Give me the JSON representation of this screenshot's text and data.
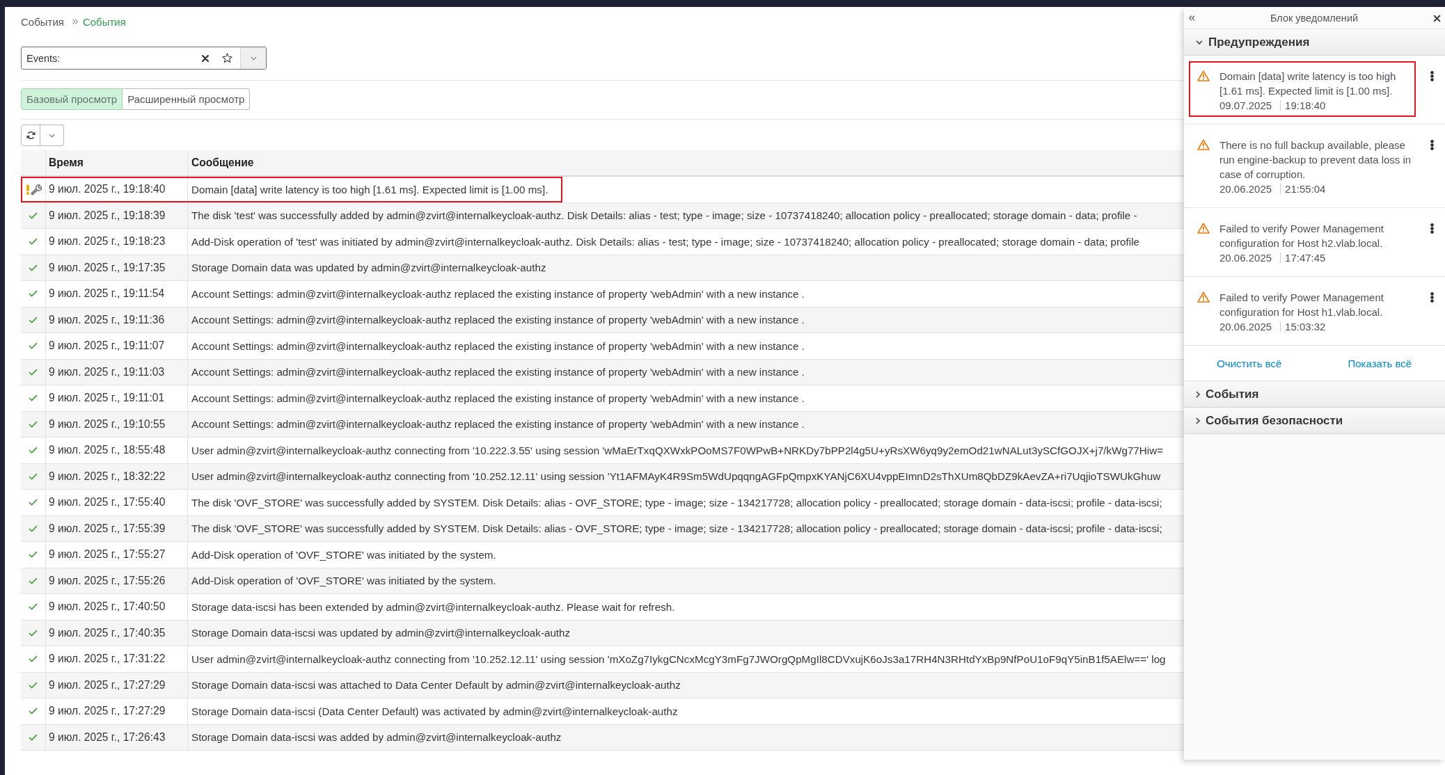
{
  "breadcrumb": [
    {
      "label": "События",
      "current": false
    },
    {
      "label": "События",
      "current": true
    }
  ],
  "search": {
    "label": "Events:"
  },
  "view_toggle": [
    {
      "label": "Базовый просмотр",
      "selected": true
    },
    {
      "label": "Расширенный просмотр",
      "selected": false
    }
  ],
  "table": {
    "columns": [
      "Время",
      "Сообщение"
    ],
    "rows": [
      {
        "kind": "warning",
        "time": "9 июл. 2025 г., 19:18:40",
        "message": "Domain [data] write latency is too high [1.61 ms]. Expected limit is [1.00 ms].",
        "highlighted": true
      },
      {
        "kind": "success",
        "time": "9 июл. 2025 г., 19:18:39",
        "message": "The disk 'test' was successfully added by admin@zvirt@internalkeycloak-authz. Disk Details: alias - test; type - image; size - 10737418240; allocation policy - preallocated; storage domain - data; profile -",
        "highlighted": false
      },
      {
        "kind": "success",
        "time": "9 июл. 2025 г., 19:18:23",
        "message": "Add-Disk operation of 'test' was initiated by admin@zvirt@internalkeycloak-authz. Disk Details: alias - test; type - image; size - 10737418240; allocation policy - preallocated; storage domain - data; profile",
        "highlighted": false
      },
      {
        "kind": "success",
        "time": "9 июл. 2025 г., 19:17:35",
        "message": "Storage Domain data was updated by admin@zvirt@internalkeycloak-authz",
        "highlighted": false
      },
      {
        "kind": "success",
        "time": "9 июл. 2025 г., 19:11:54",
        "message": "Account Settings: admin@zvirt@internalkeycloak-authz replaced the existing instance of property 'webAdmin' with a new instance .",
        "highlighted": false
      },
      {
        "kind": "success",
        "time": "9 июл. 2025 г., 19:11:36",
        "message": "Account Settings: admin@zvirt@internalkeycloak-authz replaced the existing instance of property 'webAdmin' with a new instance .",
        "highlighted": false
      },
      {
        "kind": "success",
        "time": "9 июл. 2025 г., 19:11:07",
        "message": "Account Settings: admin@zvirt@internalkeycloak-authz replaced the existing instance of property 'webAdmin' with a new instance .",
        "highlighted": false
      },
      {
        "kind": "success",
        "time": "9 июл. 2025 г., 19:11:03",
        "message": "Account Settings: admin@zvirt@internalkeycloak-authz replaced the existing instance of property 'webAdmin' with a new instance .",
        "highlighted": false
      },
      {
        "kind": "success",
        "time": "9 июл. 2025 г., 19:11:01",
        "message": "Account Settings: admin@zvirt@internalkeycloak-authz replaced the existing instance of property 'webAdmin' with a new instance .",
        "highlighted": false
      },
      {
        "kind": "success",
        "time": "9 июл. 2025 г., 19:10:55",
        "message": "Account Settings: admin@zvirt@internalkeycloak-authz replaced the existing instance of property 'webAdmin' with a new instance .",
        "highlighted": false
      },
      {
        "kind": "success",
        "time": "9 июл. 2025 г., 18:55:48",
        "message": "User admin@zvirt@internalkeycloak-authz connecting from '10.222.3.55' using session 'wMaErTxqQXWxkPOoMS7F0WPwB+NRKDy7bPP2l4g5U+yRsXW6yq9y2emOd21wNALut3ySCfGOJX+j7/kWg77Hiw=",
        "highlighted": false
      },
      {
        "kind": "success",
        "time": "9 июл. 2025 г., 18:32:22",
        "message": "User admin@zvirt@internalkeycloak-authz connecting from '10.252.12.11' using session 'Yt1AFMAyK4R9Sm5WdUpqqngAGFpQmpxKYANjC6XU4vppEImnD2sThXUm8QbDZ9kAevZA+ri7UqjioTSWUkGhuw",
        "highlighted": false
      },
      {
        "kind": "success",
        "time": "9 июл. 2025 г., 17:55:40",
        "message": "The disk 'OVF_STORE' was successfully added by SYSTEM. Disk Details: alias - OVF_STORE; type - image; size - 134217728; allocation policy - preallocated; storage domain - data-iscsi; profile - data-iscsi;",
        "highlighted": false
      },
      {
        "kind": "success",
        "time": "9 июл. 2025 г., 17:55:39",
        "message": "The disk 'OVF_STORE' was successfully added by SYSTEM. Disk Details: alias - OVF_STORE; type - image; size - 134217728; allocation policy - preallocated; storage domain - data-iscsi; profile - data-iscsi;",
        "highlighted": false
      },
      {
        "kind": "success",
        "time": "9 июл. 2025 г., 17:55:27",
        "message": "Add-Disk operation of 'OVF_STORE' was initiated by the system.",
        "highlighted": false
      },
      {
        "kind": "success",
        "time": "9 июл. 2025 г., 17:55:26",
        "message": "Add-Disk operation of 'OVF_STORE' was initiated by the system.",
        "highlighted": false
      },
      {
        "kind": "success",
        "time": "9 июл. 2025 г., 17:40:50",
        "message": "Storage data-iscsi has been extended by admin@zvirt@internalkeycloak-authz. Please wait for refresh.",
        "highlighted": false
      },
      {
        "kind": "success",
        "time": "9 июл. 2025 г., 17:40:35",
        "message": "Storage Domain data-iscsi was updated by admin@zvirt@internalkeycloak-authz",
        "highlighted": false
      },
      {
        "kind": "success",
        "time": "9 июл. 2025 г., 17:31:22",
        "message": "User admin@zvirt@internalkeycloak-authz connecting from '10.252.12.11' using session 'mXoZg7IykgCNcxMcgY3mFg7JWOrgQpMgIl8CDVxujK6oJs3a17RH4N3RHtdYxBp9NfPoU1oF9qY5inB1f5AElw==' log",
        "highlighted": false
      },
      {
        "kind": "success",
        "time": "9 июл. 2025 г., 17:27:29",
        "message": "Storage Domain data-iscsi was attached to Data Center Default by admin@zvirt@internalkeycloak-authz",
        "highlighted": false
      },
      {
        "kind": "success",
        "time": "9 июл. 2025 г., 17:27:29",
        "message": "Storage Domain data-iscsi (Data Center Default) was activated by admin@zvirt@internalkeycloak-authz",
        "highlighted": false
      },
      {
        "kind": "success",
        "time": "9 июл. 2025 г., 17:26:43",
        "message": "Storage Domain data-iscsi was added by admin@zvirt@internalkeycloak-authz",
        "highlighted": false
      }
    ]
  },
  "notification_panel": {
    "title": "Блок уведомлений",
    "sections": [
      {
        "title": "Предупреждения",
        "expanded": true,
        "items": [
          {
            "message": "Domain [data] write latency is too high [1.61 ms]. Expected limit is [1.00 ms].",
            "date": "09.07.2025",
            "time": "19:18:40",
            "highlighted": true
          },
          {
            "message": "There is no full backup available, please run engine-backup to prevent data loss in case of corruption.",
            "date": "20.06.2025",
            "time": "21:55:04",
            "highlighted": false
          },
          {
            "message": "Failed to verify Power Management configuration for Host h2.vlab.local.",
            "date": "20.06.2025",
            "time": "17:47:45",
            "highlighted": false
          },
          {
            "message": "Failed to verify Power Management configuration for Host h1.vlab.local.",
            "date": "20.06.2025",
            "time": "15:03:32",
            "highlighted": false
          }
        ],
        "actions": [
          "Очистить всё",
          "Показать всё"
        ]
      },
      {
        "title": "События",
        "expanded": false
      },
      {
        "title": "События безопасности",
        "expanded": false
      }
    ]
  }
}
